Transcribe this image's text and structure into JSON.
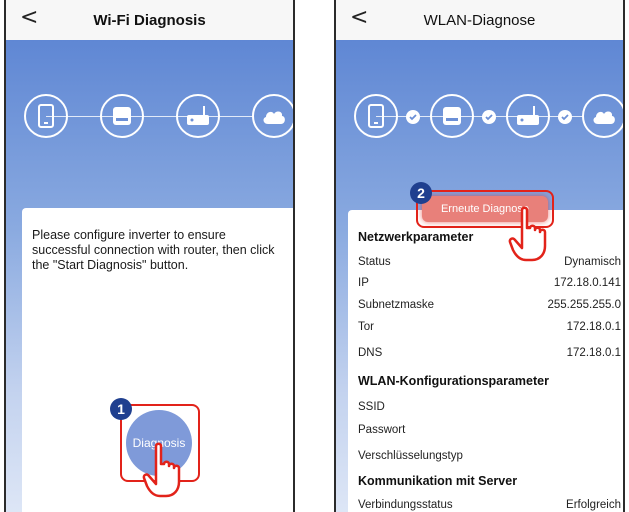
{
  "left_screen": {
    "nav": {
      "back": "<",
      "title": "Wi-Fi Diagnosis"
    },
    "message": "Please configure inverter to ensure successful connection with router, then click the \"Start Diagnosis\" button.",
    "button_label": "Diagnosis",
    "step_number": "1"
  },
  "right_screen": {
    "nav": {
      "back": "<",
      "title": "WLAN-Diagnose"
    },
    "button_label": "Erneute Diagnose",
    "step_number": "2",
    "network": {
      "title": "Netzwerkparameter",
      "rows": [
        {
          "label": "Status",
          "value": "Dynamisch"
        },
        {
          "label": "IP",
          "value": "172.18.0.141"
        },
        {
          "label": "Subnetzmaske",
          "value": "255.255.255.0"
        },
        {
          "label": "Tor",
          "value": "172.18.0.1"
        },
        {
          "label": "DNS",
          "value": "172.18.0.1"
        }
      ]
    },
    "wlan": {
      "title": "WLAN-Konfigurationsparameter",
      "rows": [
        {
          "label": "SSID",
          "value": ""
        },
        {
          "label": "Passwort",
          "value": ""
        },
        {
          "label": "Verschlüsselungstyp",
          "value": ""
        }
      ]
    },
    "server": {
      "title": "Kommunikation mit Server",
      "rows": [
        {
          "label": "Verbindungsstatus",
          "value": "Erfolgreich"
        }
      ]
    }
  },
  "steps": [
    "phone-icon",
    "inverter-icon",
    "router-icon",
    "cloud-icon"
  ],
  "colors": {
    "accent": "#5f87d4",
    "highlight": "#e2231a",
    "badge": "#1f3f8f"
  }
}
